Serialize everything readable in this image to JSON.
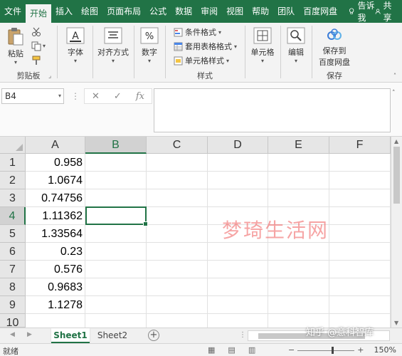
{
  "ribbon_tabs": [
    "文件",
    "开始",
    "插入",
    "绘图",
    "页面布局",
    "公式",
    "数据",
    "审阅",
    "视图",
    "帮助",
    "团队",
    "百度网盘"
  ],
  "active_tab_index": 1,
  "tell_me": "告诉我",
  "share": "共享",
  "groups": {
    "clipboard": {
      "paste": "粘贴",
      "label": "剪贴板"
    },
    "font": {
      "label": "字体"
    },
    "alignment": {
      "label": "对齐方式"
    },
    "number": {
      "label": "数字"
    },
    "styles": {
      "conditional": "条件格式",
      "table": "套用表格格式",
      "cell_styles": "单元格样式",
      "label": "样式"
    },
    "cells": {
      "label": "单元格"
    },
    "editing": {
      "label": "编辑"
    },
    "save": {
      "line1": "保存到",
      "line2": "百度网盘",
      "label": "保存"
    }
  },
  "formula_bar": {
    "name_box": "B4",
    "fx": "fx",
    "value": ""
  },
  "columns": [
    "A",
    "B",
    "C",
    "D",
    "E",
    "F"
  ],
  "selected_column": "B",
  "rows": [
    "1",
    "2",
    "3",
    "4",
    "5",
    "6",
    "7",
    "8",
    "9",
    "10"
  ],
  "selected_row": "4",
  "column_a_values": [
    "0.958",
    "1.0674",
    "0.74756",
    "1.11362",
    "1.33564",
    "0.23",
    "0.576",
    "0.9683",
    "1.1278",
    ""
  ],
  "watermark": "梦琦生活网",
  "sheets": [
    "Sheet1",
    "Sheet2"
  ],
  "active_sheet": "Sheet1",
  "status": {
    "ready": "就绪",
    "zoom": "150%"
  },
  "overlay_text": "知乎 @意科智库",
  "accent": "#217346"
}
